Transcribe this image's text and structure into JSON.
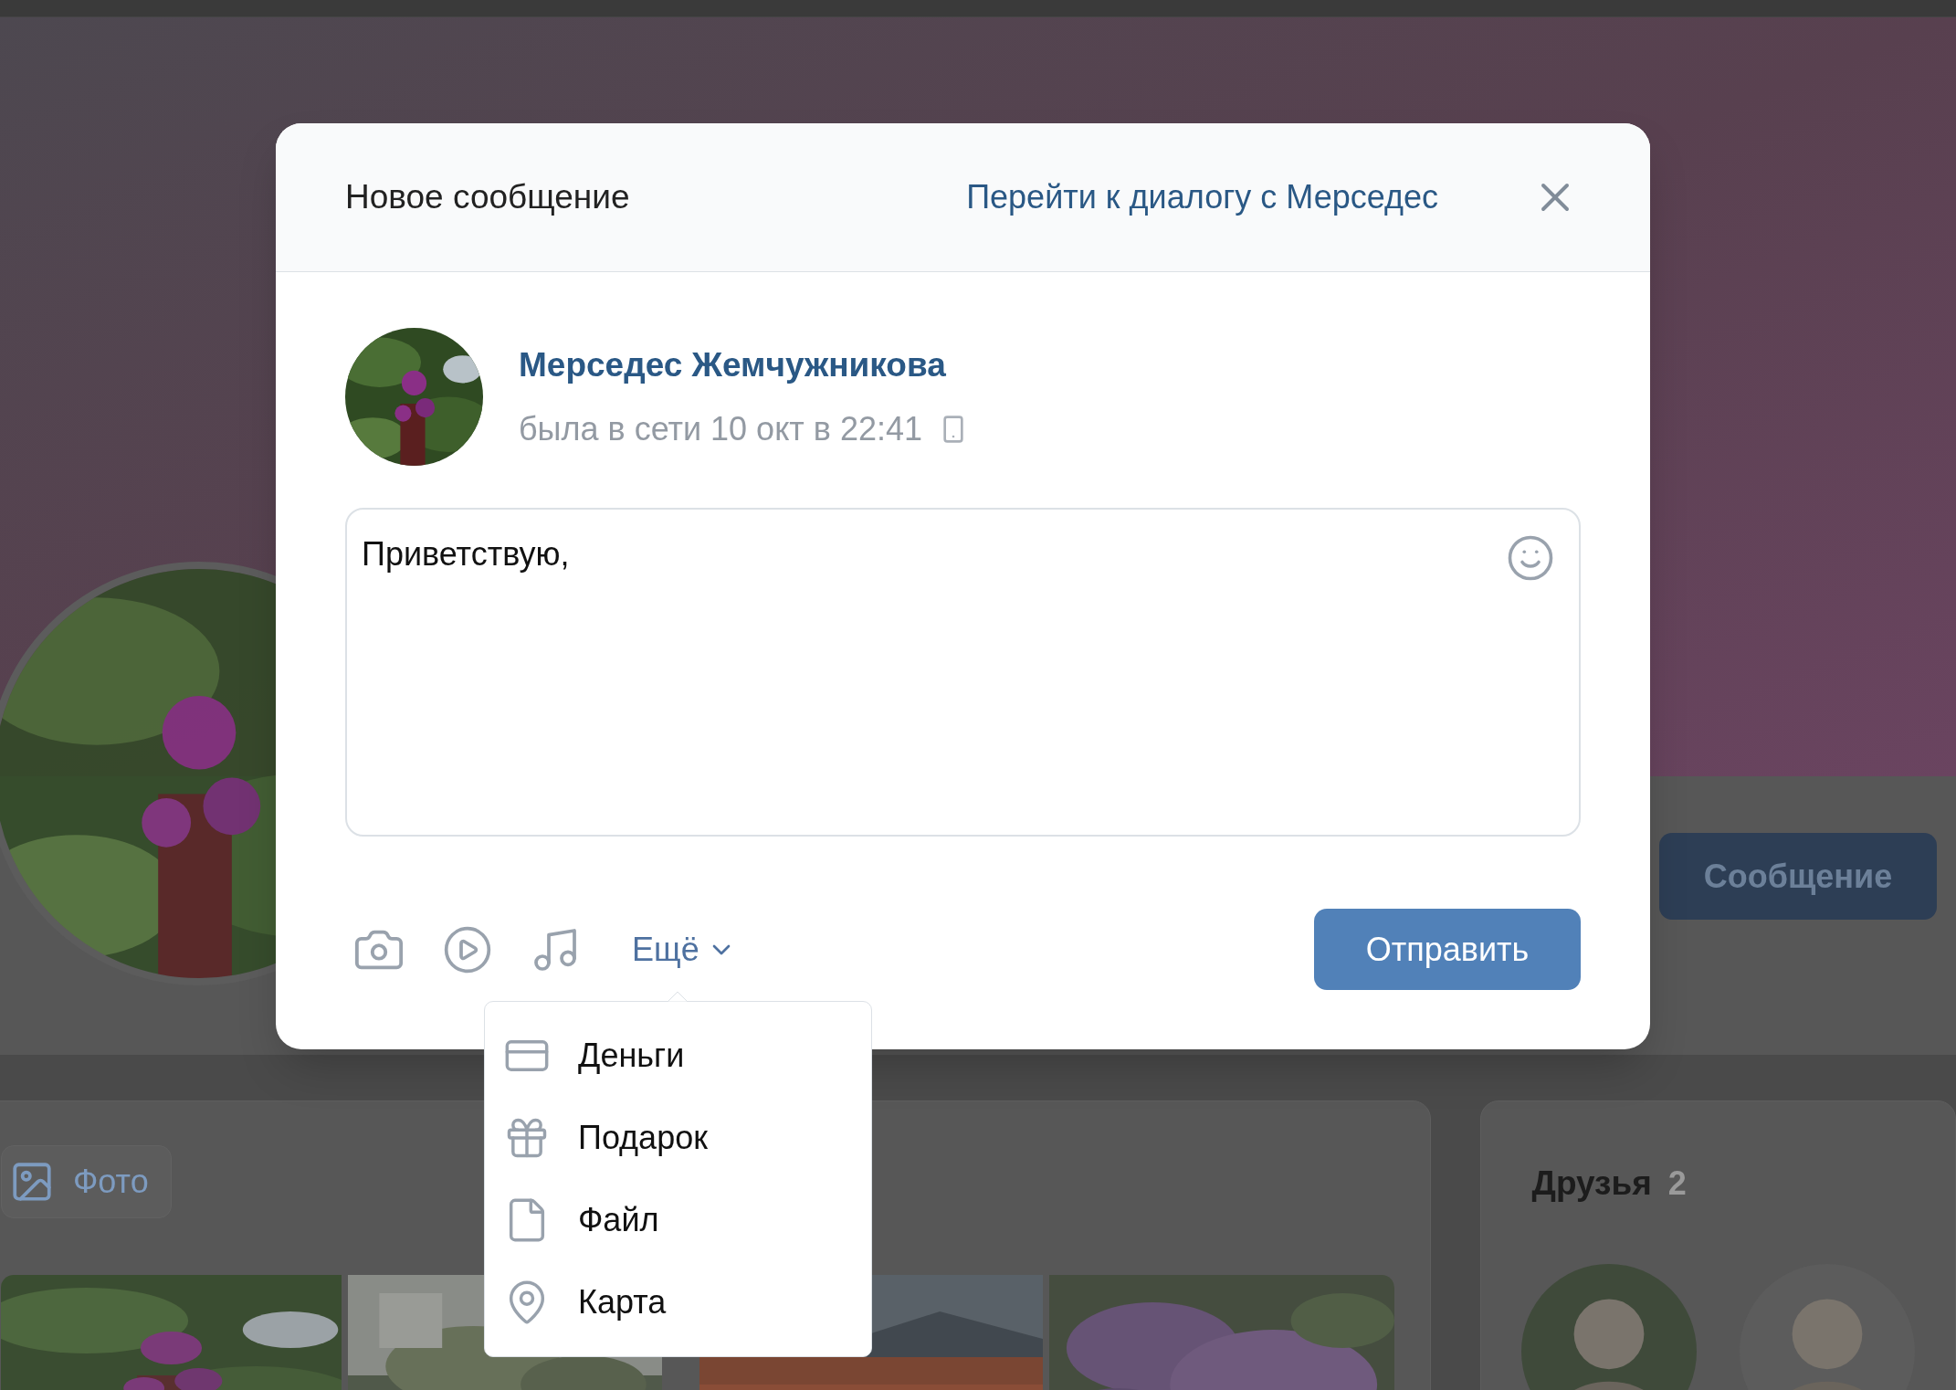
{
  "page": {
    "message_button": "Сообщение",
    "photos_tab": "Фото",
    "friends": {
      "title": "Друзья",
      "count": "2"
    }
  },
  "dialog": {
    "title": "Новое сообщение",
    "dialog_link": "Перейти к диалогу с Мерседес",
    "recipient": {
      "name": "Мерседес Жемчужникова",
      "status": "была в сети 10 окт в 22:41"
    },
    "message": {
      "value": "Приветствую,"
    },
    "more_button": "Ещё",
    "send_button": "Отправить",
    "more_menu": {
      "expanded": true,
      "items": [
        {
          "kind": "money",
          "label": "Деньги"
        },
        {
          "kind": "gift",
          "label": "Подарок"
        },
        {
          "kind": "file",
          "label": "Файл"
        },
        {
          "kind": "map",
          "label": "Карта"
        }
      ]
    }
  }
}
